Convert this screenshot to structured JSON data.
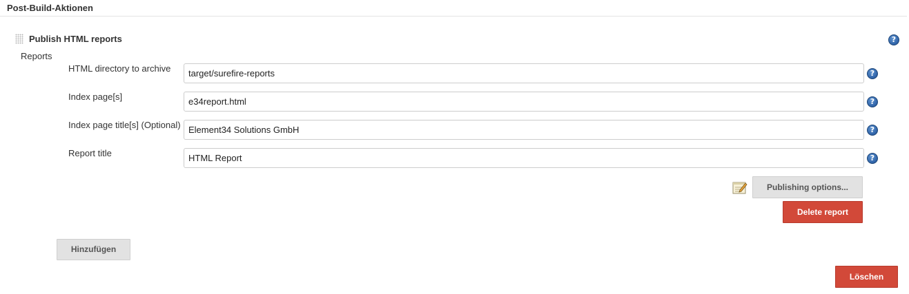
{
  "section": {
    "title": "Post-Build-Aktionen"
  },
  "publisher": {
    "title": "Publish HTML reports",
    "reports_label": "Reports",
    "fields": [
      {
        "label": "HTML directory to archive",
        "value": "target/surefire-reports"
      },
      {
        "label": "Index page[s]",
        "value": "e34report.html"
      },
      {
        "label": "Index page title[s] (Optional)",
        "value": "Element34 Solutions GmbH"
      },
      {
        "label": "Report title",
        "value": "HTML Report"
      }
    ],
    "publishing_options_label": "Publishing options...",
    "delete_report_label": "Delete report",
    "add_label": "Hinzufügen",
    "delete_label": "Löschen",
    "help_glyph": "?"
  },
  "icons": {
    "help": "help-icon",
    "drag": "drag-handle-icon",
    "notepad": "notepad-icon"
  },
  "colors": {
    "danger": "#d24939",
    "help_blue": "#2f63a8",
    "button_grey": "#e2e2e2"
  }
}
